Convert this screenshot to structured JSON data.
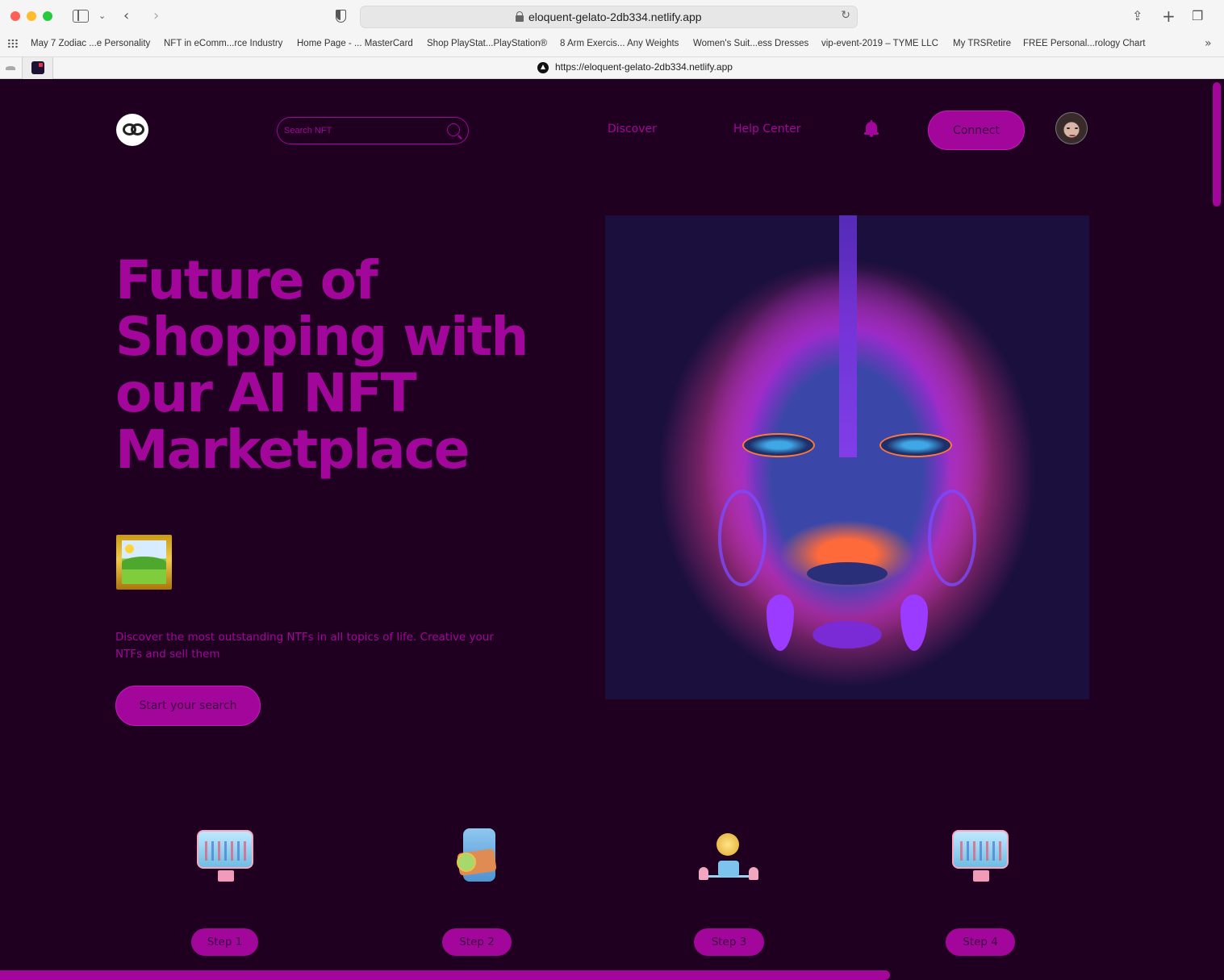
{
  "browser": {
    "url": "eloquent-gelato-2db334.netlify.app",
    "tab_url": "https://eloquent-gelato-2db334.netlify.app",
    "bookmarks": [
      "May 7 Zodiac ...e Personality",
      "NFT in eComm...rce Industry",
      "Home Page - ... MasterCard",
      "Shop PlayStat...PlayStation®",
      "8 Arm Exercis... Any Weights",
      "Women's Suit...ess Dresses",
      "vip-event-2019 – TYME LLC",
      "My TRSRetire",
      "FREE Personal...rology Chart"
    ]
  },
  "nav": {
    "search_placeholder": "Search NFT",
    "discover": "Discover",
    "help_center": "Help Center",
    "connect": "Connect"
  },
  "hero": {
    "title": "Future of Shopping with our AI NFT Marketplace",
    "subtitle": "Discover the most outstanding NTFs in all topics of life. Creative your NTFs and sell them",
    "cta": "Start your search"
  },
  "steps": [
    {
      "label": "Step 1",
      "icon": "monitor-chart-icon"
    },
    {
      "label": "Step 2",
      "icon": "phone-wallet-icon"
    },
    {
      "label": "Step 3",
      "icon": "coin-network-icon"
    },
    {
      "label": "Step 4",
      "icon": "monitor-chart-icon"
    }
  ],
  "colors": {
    "background": "#1f0020",
    "accent": "#a3069a",
    "button_text": "#3d0342"
  }
}
